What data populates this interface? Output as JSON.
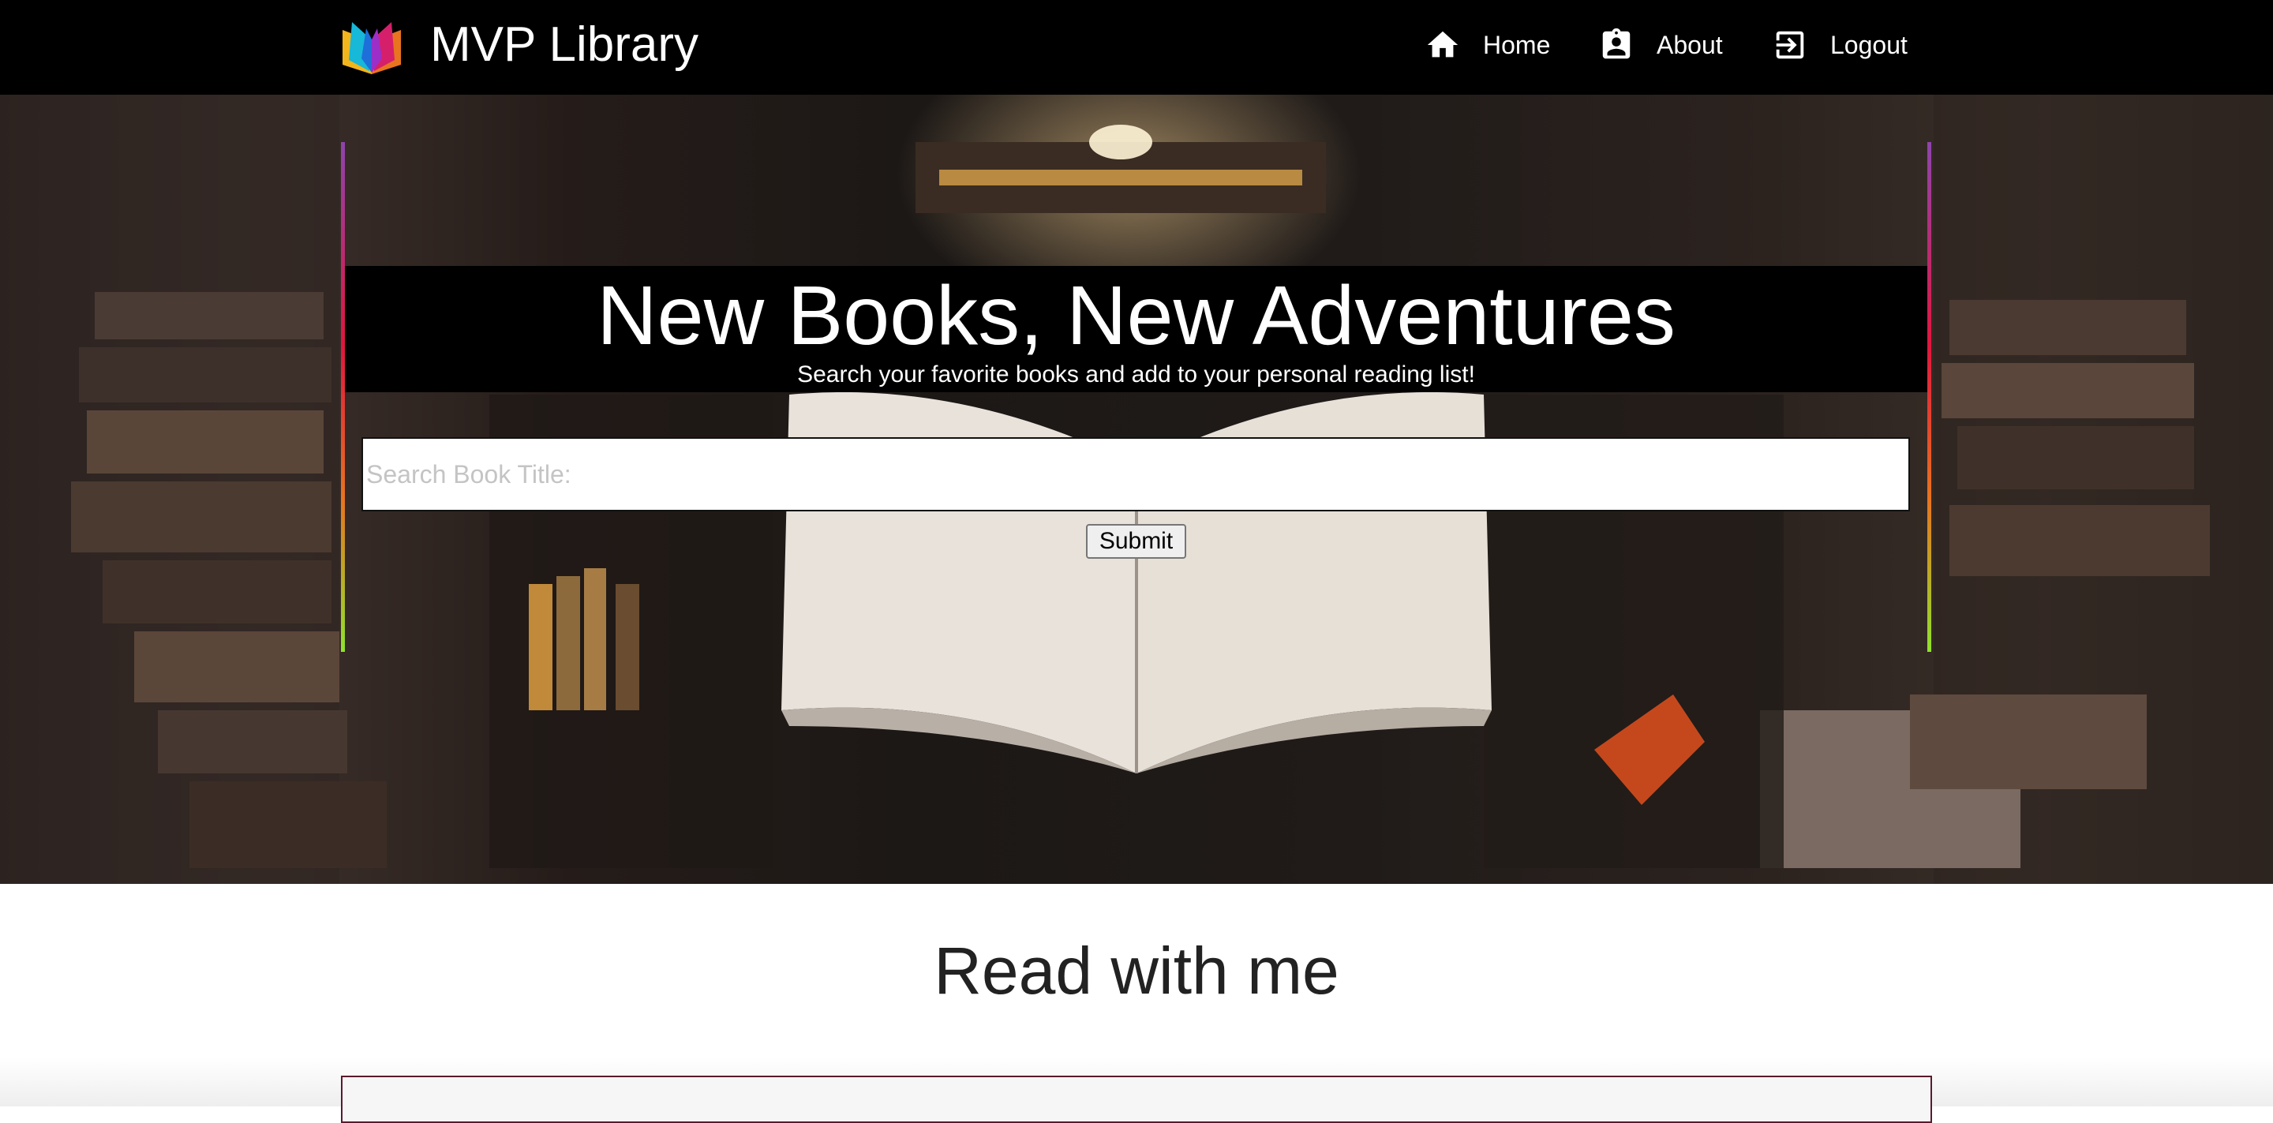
{
  "navbar": {
    "brand_title": "MVP Library",
    "brand_logo_icon": "open-book-logo-icon",
    "items": [
      {
        "label": "Home",
        "icon": "home-icon"
      },
      {
        "label": "About",
        "icon": "clipboard-account-icon"
      },
      {
        "label": "Logout",
        "icon": "logout-icon"
      }
    ]
  },
  "hero": {
    "title": "New Books, New Adventures",
    "subtitle": "Search your favorite books and add to your personal reading list!",
    "search": {
      "placeholder": "Search Book Title:",
      "value": ""
    },
    "submit_label": "Submit"
  },
  "main": {
    "section_title": "Read with me"
  },
  "colors": {
    "navbar_bg": "#000000",
    "accent_gradient": [
      "#8e44ad",
      "#e0163e",
      "#e8741f",
      "#8fe22c"
    ],
    "card_border": "#5a1a2c"
  }
}
